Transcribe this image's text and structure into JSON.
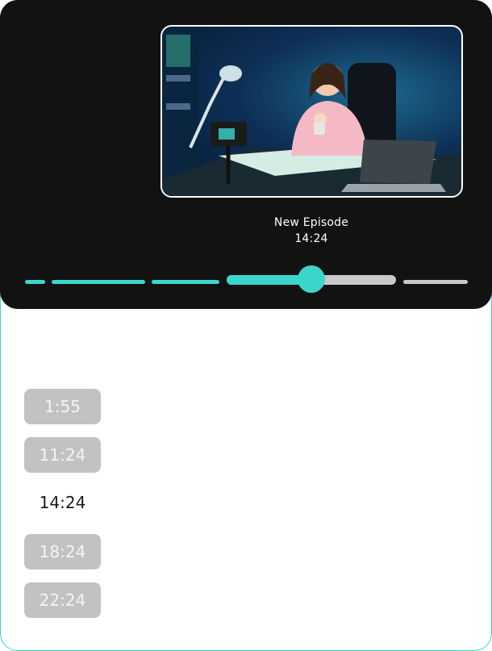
{
  "episode": {
    "title": "New Episode",
    "time": "14:24"
  },
  "thumbnail": {
    "icon": "video-thumbnail-image",
    "description_name": "episode-thumbnail"
  },
  "progress": {
    "active_segment_fill": 0.5,
    "colors": {
      "played": "#3ad6cc",
      "unplayed": "#c9c9c9"
    }
  },
  "timestamps": [
    {
      "label": "1:55"
    },
    {
      "label": "11:24"
    },
    {
      "label": "14:24",
      "current": true
    },
    {
      "label": "18:24"
    },
    {
      "label": "22:24"
    }
  ],
  "colors": {
    "accent": "#3ad6cc",
    "player_bg": "#121212"
  }
}
